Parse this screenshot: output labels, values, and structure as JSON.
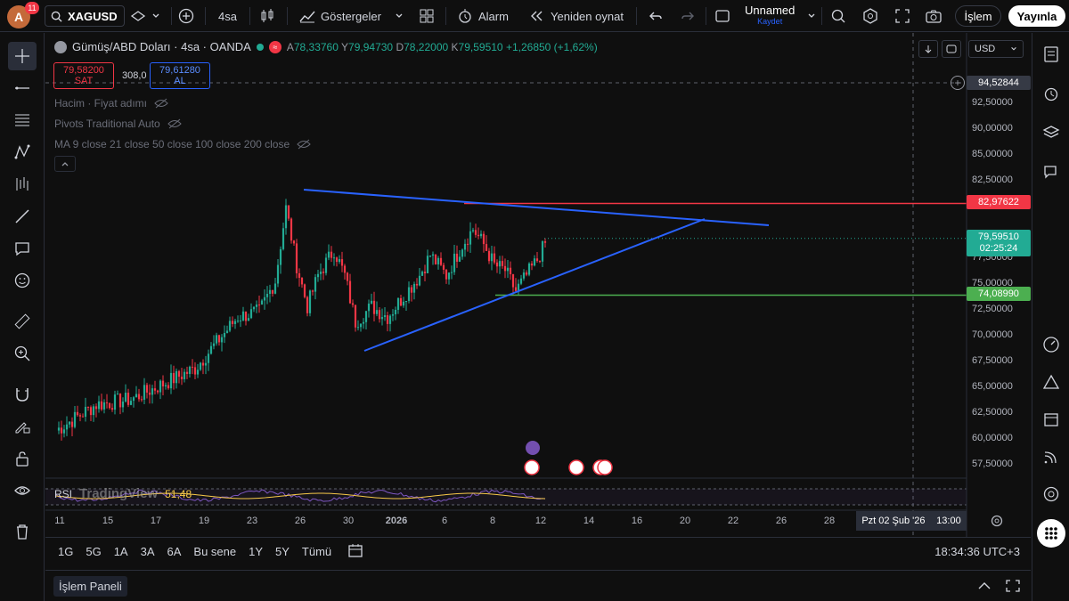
{
  "topbar": {
    "notification_count": "11",
    "avatar_letter": "A",
    "symbol": "XAGUSD",
    "interval": "4sa",
    "indicators_label": "Göstergeler",
    "alert_label": "Alarm",
    "replay_label": "Yeniden oynat",
    "layout_name": "Unnamed",
    "layout_save": "Kaydet",
    "trade_button": "İşlem",
    "publish_button": "Yayınla"
  },
  "legend": {
    "title": "Gümüş/ABD Doları · 4sa · OANDA",
    "open_k": "A",
    "open": "78,33760",
    "high_k": "Y",
    "high": "79,94730",
    "low_k": "D",
    "low": "78,22000",
    "close_k": "K",
    "close": "79,59510",
    "change": "+1,26850 (+1,62%)",
    "sell_price": "79,58200",
    "sell_label": "SAT",
    "spread": "308,0",
    "buy_price": "79,61280",
    "buy_label": "AL",
    "indicators": [
      "Hacim · Fiyat adımı",
      "Pivots Traditional Auto",
      "MA 9 close 21 close 50 close 100 close 200 close"
    ],
    "rsi_label": "RSI",
    "rsi_values": "51,48",
    "watermark": "TradingView"
  },
  "price_axis": {
    "currency": "USD",
    "labels": [
      "92,50000",
      "90,00000",
      "85,00000",
      "82,50000",
      "77,50000",
      "75,00000",
      "72,50000",
      "70,00000",
      "67,50000",
      "65,00000",
      "62,50000",
      "60,00000",
      "57,50000"
    ],
    "crosshair_price": "94,52844",
    "resistance": "82,97622",
    "current_price": "79,59510",
    "countdown": "02:25:24",
    "support": "74,08990"
  },
  "time_axis": {
    "labels": [
      "11",
      "15",
      "17",
      "19",
      "23",
      "26",
      "30",
      "2026",
      "6",
      "8",
      "12",
      "14",
      "16",
      "20",
      "22",
      "26",
      "28"
    ],
    "crosshair_date": "Pzt 02 Şub '26",
    "crosshair_time": "13:00"
  },
  "bottom": {
    "ranges": [
      "1G",
      "5G",
      "1A",
      "3A",
      "6A",
      "Bu sene",
      "1Y",
      "5Y",
      "Tümü"
    ],
    "clock": "18:34:36 UTC+3",
    "panel_tab": "İşlem Paneli"
  },
  "colors": {
    "up": "#22ab94",
    "down": "#f23645",
    "trendline": "#2962ff",
    "resistance": "#f23645",
    "support": "#4caf50"
  }
}
